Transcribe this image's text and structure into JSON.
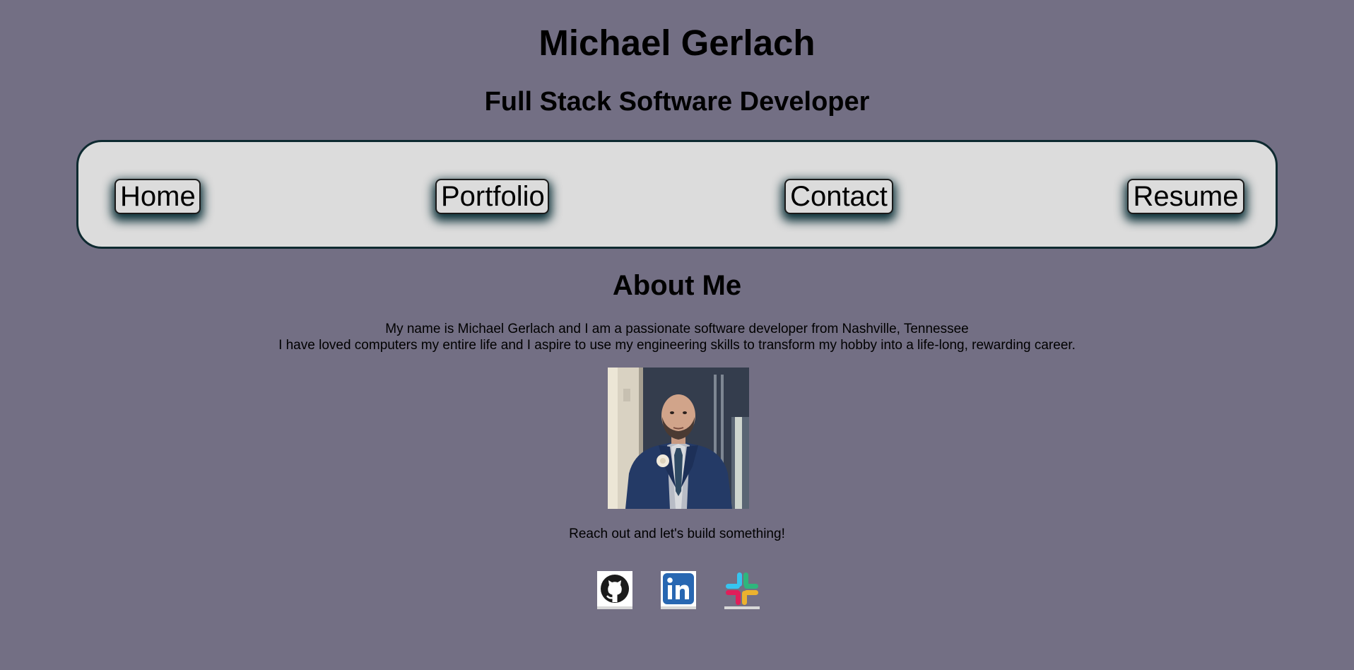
{
  "header": {
    "name": "Michael Gerlach",
    "tagline": "Full Stack Software Developer"
  },
  "nav": {
    "items": [
      {
        "label": "Home"
      },
      {
        "label": "Portfolio"
      },
      {
        "label": "Contact"
      },
      {
        "label": "Resume"
      }
    ]
  },
  "about": {
    "heading": "About Me",
    "bio_line1": "My name is Michael Gerlach and I am a passionate software developer from Nashville, Tennessee",
    "bio_line2": "I have loved computers my entire life and I aspire to use my engineering skills to transform my hobby into a life-long, rewarding career.",
    "cta": "Reach out and let's build something!"
  },
  "social": {
    "links": [
      {
        "icon": "github-icon"
      },
      {
        "icon": "linkedin-icon"
      },
      {
        "icon": "slack-icon"
      }
    ]
  },
  "colors": {
    "background": "#736f84",
    "nav_background": "#dcdcdc",
    "nav_border": "#0e2a30",
    "button_glow": "#0b3038",
    "linkedin_blue": "#2867b2"
  }
}
